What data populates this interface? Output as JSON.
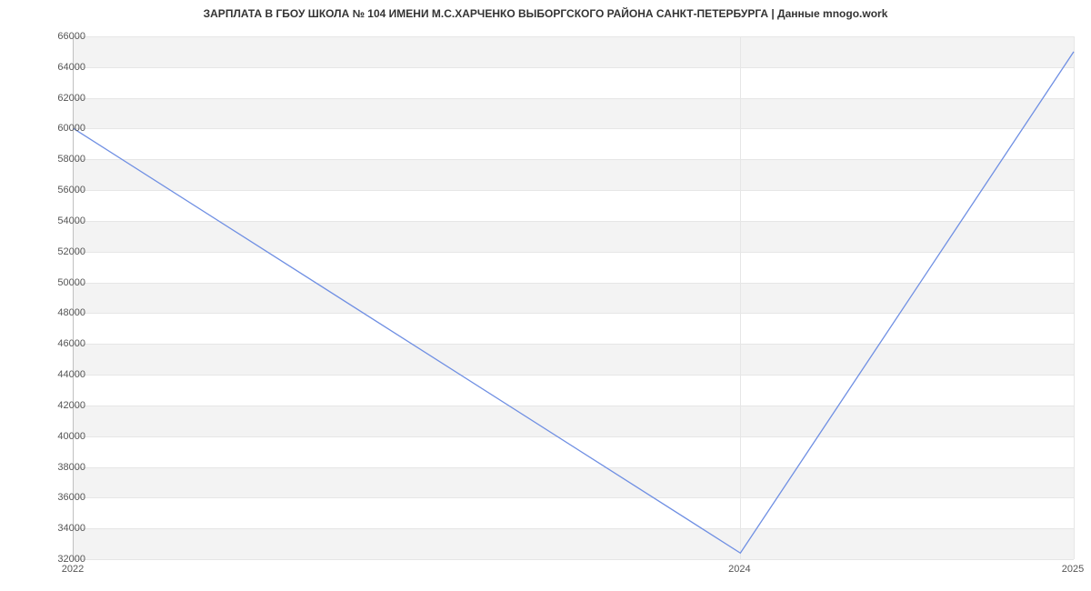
{
  "chart_data": {
    "type": "line",
    "title": "ЗАРПЛАТА В ГБОУ ШКОЛА № 104 ИМЕНИ М.С.ХАРЧЕНКО ВЫБОРГСКОГО РАЙОНА САНКТ-ПЕТЕРБУРГА | Данные mnogo.work",
    "x": [
      2022,
      2024,
      2025
    ],
    "values": [
      60000,
      32400,
      65000
    ],
    "x_ticks": [
      2022,
      2024,
      2025
    ],
    "y_ticks": [
      32000,
      34000,
      36000,
      38000,
      40000,
      42000,
      44000,
      46000,
      48000,
      50000,
      52000,
      54000,
      56000,
      58000,
      60000,
      62000,
      64000,
      66000
    ],
    "ylim": [
      32000,
      66000
    ],
    "xlim": [
      2022,
      2025
    ],
    "line_color": "#6f8fe3",
    "xlabel": "",
    "ylabel": ""
  }
}
